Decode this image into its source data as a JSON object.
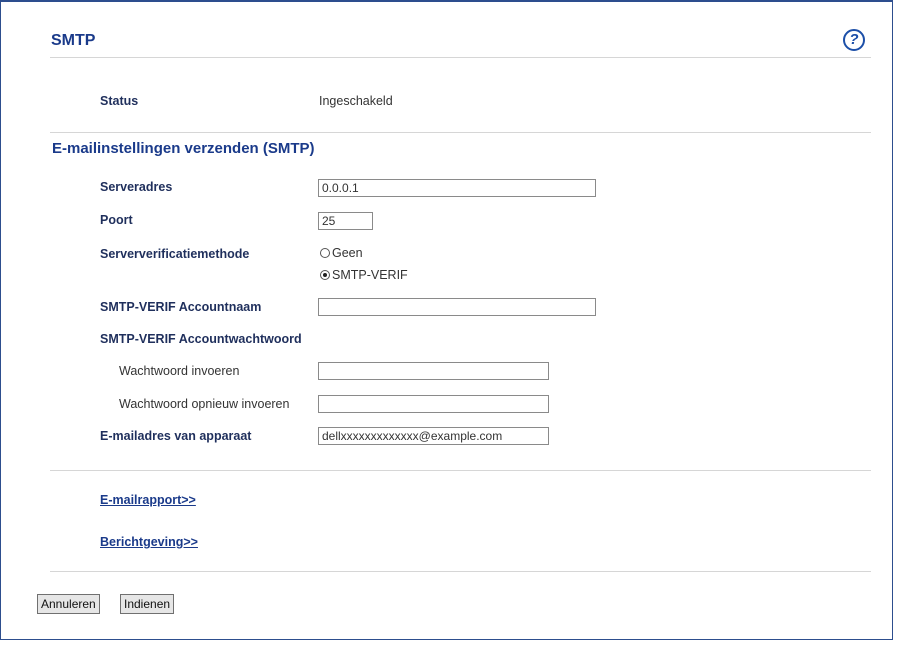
{
  "header": {
    "title": "SMTP",
    "help_icon": "help-icon"
  },
  "status": {
    "label": "Status",
    "value": "Ingeschakeld"
  },
  "section": {
    "title": "E-mailinstellingen verzenden (SMTP)"
  },
  "form": {
    "server_address": {
      "label": "Serveradres",
      "value": "0.0.0.1"
    },
    "port": {
      "label": "Poort",
      "value": "25"
    },
    "auth_method": {
      "label": "Serververificatiemethode",
      "options": [
        {
          "label": "Geen",
          "selected": false
        },
        {
          "label": "SMTP-VERIF",
          "selected": true
        }
      ]
    },
    "account_name": {
      "label": "SMTP-VERIF Accountnaam",
      "value": ""
    },
    "account_password": {
      "label": "SMTP-VERIF Accountwachtwoord",
      "enter_label": "Wachtwoord invoeren",
      "reenter_label": "Wachtwoord opnieuw invoeren"
    },
    "device_email": {
      "label": "E-mailadres van apparaat",
      "value": "dellxxxxxxxxxxxxx@example.com"
    }
  },
  "links": {
    "email_report": "E-mailrapport>>",
    "notification": "Berichtgeving>>"
  },
  "buttons": {
    "cancel": "Annuleren",
    "submit": "Indienen"
  }
}
